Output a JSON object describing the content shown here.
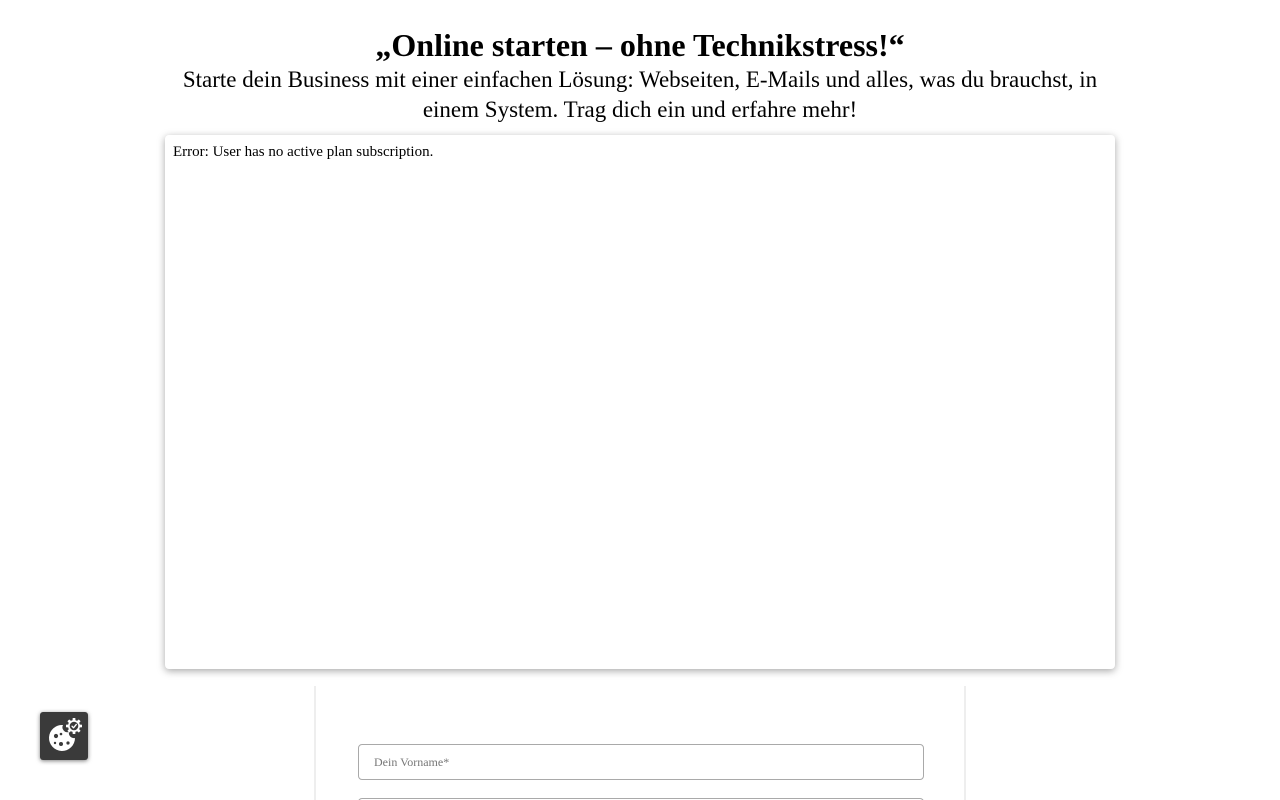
{
  "hero": {
    "headline": "„Online starten – ohne Technikstress!“",
    "subline": "Starte dein Business mit einer einfachen Lösung: Webseiten, E-Mails und alles, was du brauchst, in einem System. Trag dich ein und erfahre mehr!"
  },
  "embed": {
    "error_text": "Error: User has no active plan subscription."
  },
  "form": {
    "firstname_placeholder": "Dein Vorname*",
    "firstname_value": ""
  },
  "cookie_widget": {
    "icon": "cookie-settings-icon",
    "background": "#3a3a3a"
  }
}
